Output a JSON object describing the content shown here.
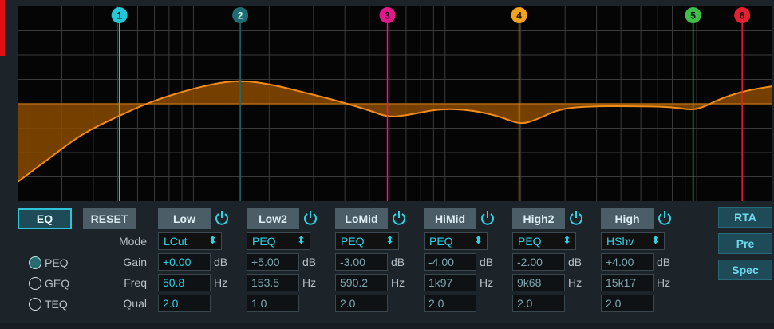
{
  "graph": {
    "bands": [
      {
        "id": "1",
        "color": "#25c6d6",
        "freq": 50.8
      },
      {
        "id": "2",
        "color": "#1f6d72",
        "freq": 153.5
      },
      {
        "id": "3",
        "color": "#e0188a",
        "freq": 590.2
      },
      {
        "id": "4",
        "color": "#f2a21c",
        "freq": 1970
      },
      {
        "id": "5",
        "color": "#3fbf4a",
        "freq": 9680
      },
      {
        "id": "6",
        "color": "#e52030",
        "freq": 15170
      }
    ]
  },
  "controls": {
    "eq_label": "EQ",
    "reset_label": "RESET",
    "rows": {
      "mode": "Mode",
      "gain": "Gain",
      "freq": "Freq",
      "qual": "Qual"
    },
    "bands": [
      {
        "name": "Low",
        "mode": "LCut",
        "gain": "+0.00",
        "gain_unit": "dB",
        "freq": "50.8",
        "freq_unit": "Hz",
        "qual": "2.0"
      },
      {
        "name": "Low2",
        "mode": "PEQ",
        "gain": "+5.00",
        "gain_unit": "dB",
        "freq": "153.5",
        "freq_unit": "Hz",
        "qual": "1.0"
      },
      {
        "name": "LoMid",
        "mode": "PEQ",
        "gain": "-3.00",
        "gain_unit": "dB",
        "freq": "590.2",
        "freq_unit": "Hz",
        "qual": "2.0"
      },
      {
        "name": "HiMid",
        "mode": "PEQ",
        "gain": "-4.00",
        "gain_unit": "dB",
        "freq": "1k97",
        "freq_unit": "Hz",
        "qual": "2.0"
      },
      {
        "name": "High2",
        "mode": "PEQ",
        "gain": "-2.00",
        "gain_unit": "dB",
        "freq": "9k68",
        "freq_unit": "Hz",
        "qual": "2.0"
      },
      {
        "name": "High",
        "mode": "HShv",
        "gain": "+4.00",
        "gain_unit": "dB",
        "freq": "15k17",
        "freq_unit": "Hz",
        "qual": "2.0"
      }
    ],
    "eq_types": [
      "PEQ",
      "GEQ",
      "TEQ"
    ],
    "selected_eq_type": "PEQ",
    "side_buttons": [
      "RTA",
      "Pre",
      "Spec"
    ]
  },
  "colors": {
    "accent": "#2ed3e6",
    "curve": "#f28c1a",
    "fill": "#8a4a00"
  }
}
